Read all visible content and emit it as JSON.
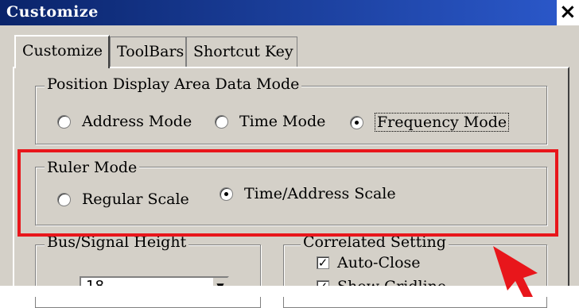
{
  "window": {
    "title": "Customize",
    "close_glyph": "×"
  },
  "tabs": [
    {
      "label": "Customize",
      "active": true
    },
    {
      "label": "ToolBars",
      "active": false
    },
    {
      "label": "Shortcut Key",
      "active": false
    }
  ],
  "position_display": {
    "legend": "Position Display Area Data Mode",
    "options": [
      {
        "label": "Address Mode",
        "checked": false
      },
      {
        "label": "Time Mode",
        "checked": false
      },
      {
        "label": "Frequency Mode",
        "checked": true
      }
    ]
  },
  "ruler_mode": {
    "legend": "Ruler Mode",
    "options": [
      {
        "label": "Regular Scale",
        "checked": false
      },
      {
        "label": "Time/Address Scale",
        "checked": true
      }
    ]
  },
  "bus_signal_height": {
    "legend": "Bus/Signal Height",
    "value": "18",
    "dropdown_glyph": "▼"
  },
  "correlated_setting": {
    "legend": "Correlated Setting",
    "checkboxes": [
      {
        "label": "Auto-Close",
        "checked": true,
        "mark": "✓"
      },
      {
        "label": "Show Gridline",
        "checked": true,
        "mark": "✓"
      }
    ]
  },
  "annotation": {
    "highlight_color": "#e8161b",
    "arrow_color": "#e8161b"
  }
}
